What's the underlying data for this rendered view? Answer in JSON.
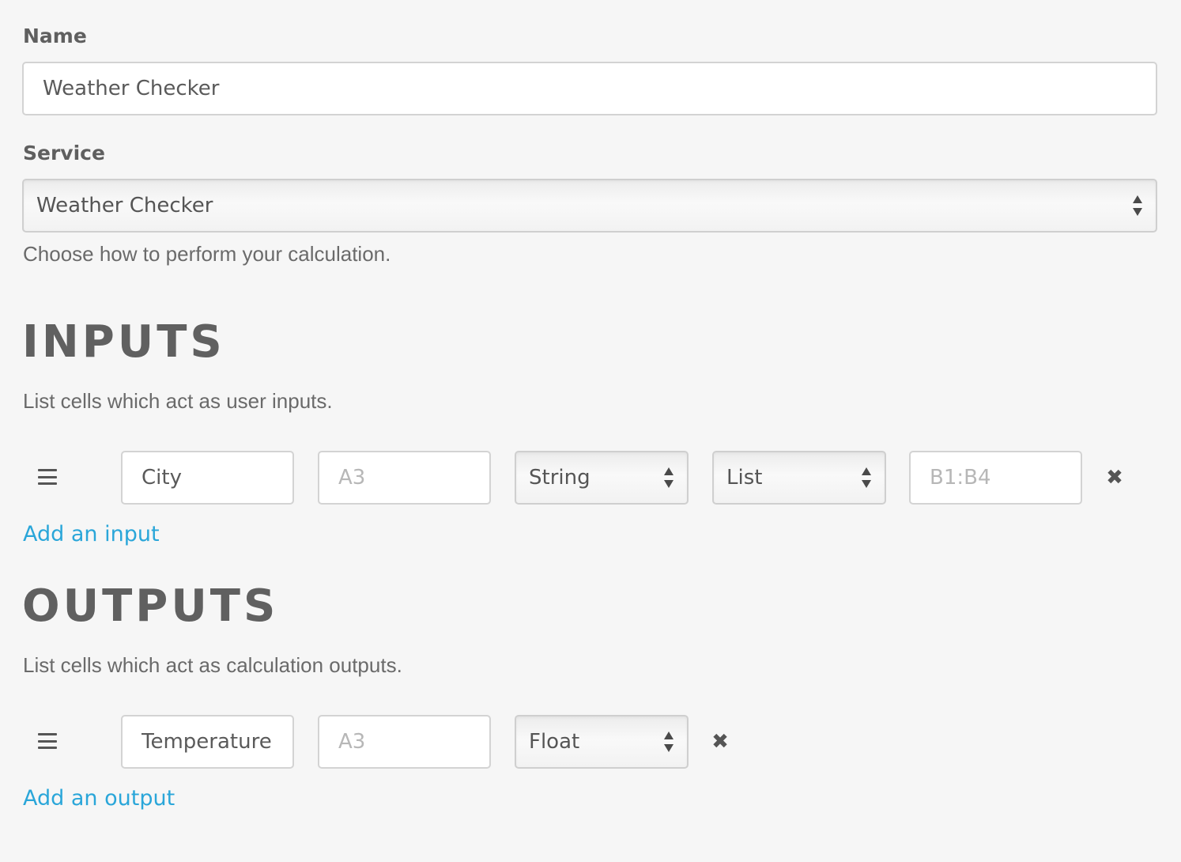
{
  "name": {
    "label": "Name",
    "value": "Weather Checker"
  },
  "service": {
    "label": "Service",
    "selected": "Weather Checker",
    "help": "Choose how to perform your calculation."
  },
  "inputs": {
    "title": "INPUTS",
    "help": "List cells which act as user inputs.",
    "rows": [
      {
        "name": "City",
        "cell_placeholder": "A3",
        "type": "String",
        "mode": "List",
        "range_placeholder": "B1:B4"
      }
    ],
    "add_label": "Add an input"
  },
  "outputs": {
    "title": "OUTPUTS",
    "help": "List cells which act as calculation outputs.",
    "rows": [
      {
        "name": "Temperature",
        "cell_placeholder": "A3",
        "type": "Float"
      }
    ],
    "add_label": "Add an output"
  },
  "icons": {
    "drag": "drag-handle-icon",
    "remove": "close-icon",
    "select": "select-arrows-icon"
  },
  "colors": {
    "background": "#f6f6f6",
    "link": "#2aa6d9",
    "text": "#5d5d5d",
    "border": "#d3d3d3"
  }
}
